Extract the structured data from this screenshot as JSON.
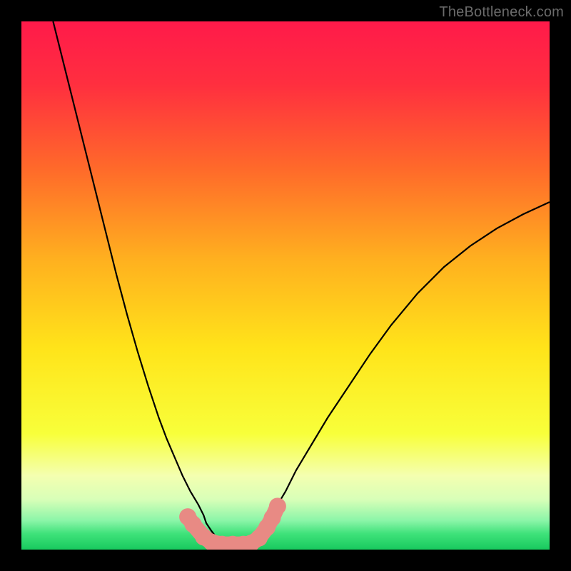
{
  "watermark": "TheBottleneck.com",
  "chart_data": {
    "type": "line",
    "title": "",
    "xlabel": "",
    "ylabel": "",
    "xlim": [
      0,
      100
    ],
    "ylim": [
      0,
      100
    ],
    "background_gradient": {
      "stops": [
        {
          "offset": 0.0,
          "color": "#ff1a4a"
        },
        {
          "offset": 0.12,
          "color": "#ff2f3f"
        },
        {
          "offset": 0.28,
          "color": "#ff6a2a"
        },
        {
          "offset": 0.45,
          "color": "#ffb01f"
        },
        {
          "offset": 0.62,
          "color": "#ffe41a"
        },
        {
          "offset": 0.78,
          "color": "#f8ff3a"
        },
        {
          "offset": 0.86,
          "color": "#f4ffb0"
        },
        {
          "offset": 0.905,
          "color": "#d8ffb8"
        },
        {
          "offset": 0.945,
          "color": "#8bf5a8"
        },
        {
          "offset": 0.97,
          "color": "#3fe27a"
        },
        {
          "offset": 1.0,
          "color": "#18c95e"
        }
      ]
    },
    "series": [
      {
        "name": "left-curve",
        "type": "line",
        "x": [
          6,
          8,
          10,
          12,
          14,
          16,
          18,
          20,
          22,
          24,
          26,
          27.5,
          29,
          30.5,
          32,
          33.5,
          34.5,
          35,
          36,
          37,
          38
        ],
        "y": [
          100,
          92,
          84,
          76,
          68,
          60,
          52,
          44.5,
          37.5,
          31,
          25,
          21,
          17.5,
          14,
          11,
          8.5,
          6.5,
          5,
          3.5,
          2.2,
          1.2
        ]
      },
      {
        "name": "right-curve",
        "type": "line",
        "x": [
          44,
          45,
          46,
          47,
          48.5,
          50,
          52,
          55,
          58,
          62,
          66,
          70,
          75,
          80,
          85,
          90,
          95,
          100
        ],
        "y": [
          1.2,
          2.5,
          4,
          6,
          8.5,
          11,
          15,
          20,
          25,
          31,
          37,
          42.5,
          48.5,
          53.5,
          57.5,
          60.8,
          63.5,
          65.8
        ]
      },
      {
        "name": "bottom-band",
        "type": "scatter",
        "x": [
          31.5,
          32.5,
          34.5,
          36,
          38,
          40,
          42,
          43.5,
          45,
          46.5,
          47.5,
          48.5
        ],
        "y": [
          6.2,
          4.8,
          2.4,
          1.4,
          1.0,
          1.0,
          1.0,
          1.2,
          2.2,
          4.2,
          6.0,
          8.2
        ],
        "marker_color": "#e88a84",
        "marker_size": 12
      }
    ]
  }
}
